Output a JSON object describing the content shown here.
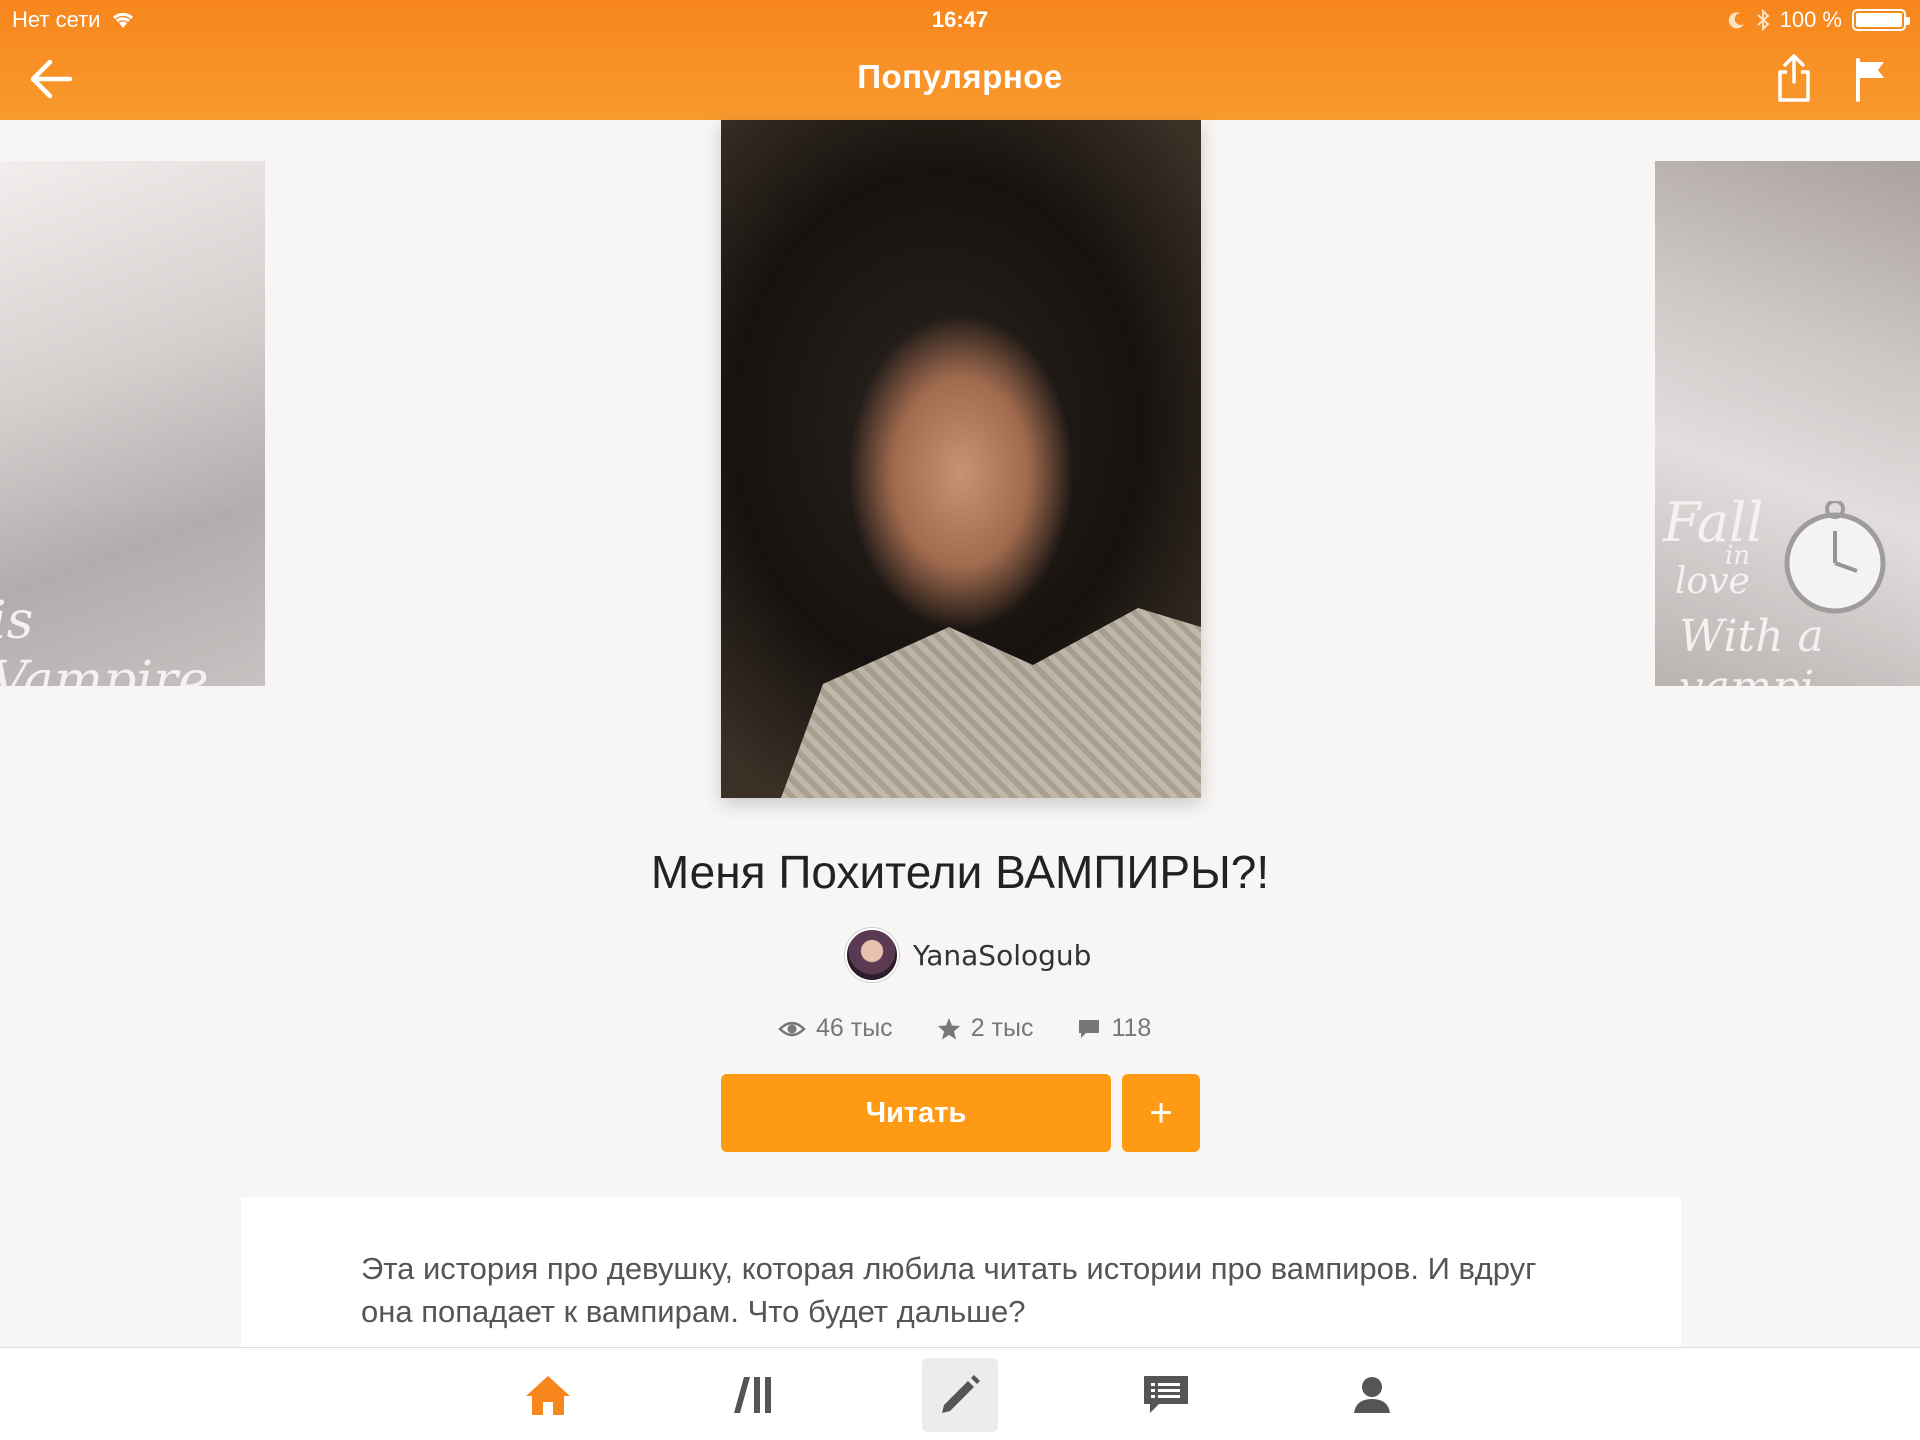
{
  "status_bar": {
    "carrier": "Нет сети",
    "time": "16:47",
    "battery_text": "100 %",
    "battery_level": 1.0
  },
  "nav": {
    "title": "Популярное",
    "back_icon": "arrow-left-icon",
    "share_icon": "share-icon",
    "flag_icon": "flag-icon"
  },
  "covers": {
    "left_text": "is Vampire",
    "right_text_1": "Fall",
    "right_text_2": "in",
    "right_text_3": "love",
    "right_text_4": "With a vampi"
  },
  "book": {
    "title": "Меня Похители ВАМПИРЫ?!",
    "author": "YanaSologub",
    "views": "46 тыс",
    "votes": "2 тыс",
    "comments": "118",
    "read_label": "Читать",
    "add_label": "+",
    "description": "Эта история про девушку, которая любила читать истории про вампиров. И вдруг она попадает к вампирам. Что будет дальше?"
  },
  "tabs": [
    {
      "name": "home",
      "icon": "home-icon",
      "active": true
    },
    {
      "name": "library",
      "icon": "library-icon"
    },
    {
      "name": "write",
      "icon": "pencil-icon"
    },
    {
      "name": "messages",
      "icon": "messages-icon"
    },
    {
      "name": "profile",
      "icon": "profile-icon"
    }
  ],
  "colors": {
    "accent": "#ff9a14",
    "header": "#f7861c",
    "active_tab": "#f7861c",
    "inactive_tab": "#555555"
  }
}
